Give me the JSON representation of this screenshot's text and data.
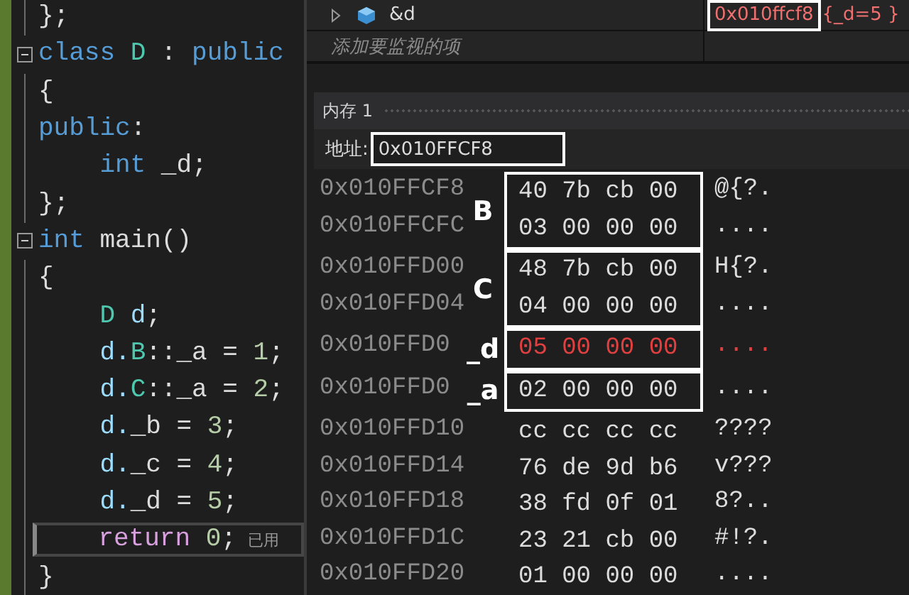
{
  "editor": {
    "lines": [
      {
        "fold": false,
        "current": false,
        "tokens": [
          {
            "kind": "text",
            "text": "};"
          }
        ]
      },
      {
        "fold": true,
        "current": false,
        "tokens": [
          {
            "kind": "kw",
            "text": "class "
          },
          {
            "kind": "type",
            "text": "D"
          },
          {
            "kind": "text",
            "text": " : "
          },
          {
            "kind": "kw",
            "text": "public"
          }
        ]
      },
      {
        "fold": false,
        "current": false,
        "tokens": [
          {
            "kind": "text",
            "text": "{"
          }
        ]
      },
      {
        "fold": false,
        "current": false,
        "tokens": [
          {
            "kind": "kw",
            "text": "public"
          },
          {
            "kind": "text",
            "text": ":"
          }
        ]
      },
      {
        "fold": false,
        "current": false,
        "tokens": [
          {
            "kind": "kw",
            "text": "    int "
          },
          {
            "kind": "text",
            "text": "_d;"
          }
        ]
      },
      {
        "fold": false,
        "current": false,
        "tokens": [
          {
            "kind": "text",
            "text": "};"
          }
        ]
      },
      {
        "fold": true,
        "current": false,
        "tokens": [
          {
            "kind": "kw",
            "text": "int "
          },
          {
            "kind": "text",
            "text": "main()"
          }
        ]
      },
      {
        "fold": false,
        "current": false,
        "tokens": [
          {
            "kind": "text",
            "text": "{"
          }
        ]
      },
      {
        "fold": false,
        "current": false,
        "tokens": [
          {
            "kind": "type",
            "text": "    D "
          },
          {
            "kind": "var",
            "text": "d"
          },
          {
            "kind": "text",
            "text": ";"
          }
        ]
      },
      {
        "fold": false,
        "current": false,
        "tokens": [
          {
            "kind": "var",
            "text": "    d."
          },
          {
            "kind": "type",
            "text": "B"
          },
          {
            "kind": "text",
            "text": "::_a = "
          },
          {
            "kind": "num",
            "text": "1"
          },
          {
            "kind": "text",
            "text": ";"
          }
        ]
      },
      {
        "fold": false,
        "current": false,
        "tokens": [
          {
            "kind": "var",
            "text": "    d."
          },
          {
            "kind": "type",
            "text": "C"
          },
          {
            "kind": "text",
            "text": "::_a = "
          },
          {
            "kind": "num",
            "text": "2"
          },
          {
            "kind": "text",
            "text": ";"
          }
        ]
      },
      {
        "fold": false,
        "current": false,
        "tokens": [
          {
            "kind": "var",
            "text": "    d."
          },
          {
            "kind": "text",
            "text": "_b = "
          },
          {
            "kind": "num",
            "text": "3"
          },
          {
            "kind": "text",
            "text": ";"
          }
        ]
      },
      {
        "fold": false,
        "current": false,
        "tokens": [
          {
            "kind": "var",
            "text": "    d."
          },
          {
            "kind": "text",
            "text": "_c = "
          },
          {
            "kind": "num",
            "text": "4"
          },
          {
            "kind": "text",
            "text": ";"
          }
        ]
      },
      {
        "fold": false,
        "current": false,
        "tokens": [
          {
            "kind": "var",
            "text": "    d."
          },
          {
            "kind": "text",
            "text": "_d = "
          },
          {
            "kind": "num",
            "text": "5"
          },
          {
            "kind": "text",
            "text": ";"
          }
        ]
      },
      {
        "fold": false,
        "current": true,
        "hint": "已用",
        "tokens": [
          {
            "kind": "ctrl",
            "text": "    return "
          },
          {
            "kind": "num",
            "text": "0"
          },
          {
            "kind": "text",
            "text": ";"
          }
        ]
      },
      {
        "fold": false,
        "current": false,
        "tokens": [
          {
            "kind": "text",
            "text": "}"
          }
        ]
      }
    ]
  },
  "watch": {
    "rows": [
      {
        "kind": "item",
        "name": "&d",
        "value": "0x010ffcf8",
        "detail": "{_d=5 }"
      },
      {
        "kind": "add",
        "name": "添加要监视的项"
      }
    ]
  },
  "memory": {
    "title": "内存 1",
    "address_label": "地址:",
    "address": "0x010FFCF8",
    "groups": [
      {
        "boxed": true,
        "label": "B",
        "rows": [
          {
            "address": "0x010FFCF8",
            "bytes": "40 7b cb 00",
            "ascii": "@{?.",
            "changed": false
          },
          {
            "address": "0x010FFCFC",
            "bytes": "03 00 00 00",
            "ascii": "....",
            "changed": false
          }
        ]
      },
      {
        "boxed": true,
        "label": "C",
        "rows": [
          {
            "address": "0x010FFD00",
            "bytes": "48 7b cb 00",
            "ascii": "H{?.",
            "changed": false
          },
          {
            "address": "0x010FFD04",
            "bytes": "04 00 00 00",
            "ascii": "....",
            "changed": false
          }
        ]
      },
      {
        "boxed": true,
        "label": "_d",
        "rows": [
          {
            "address": "0x010FFD0",
            "bytes": "05 00 00 00",
            "ascii": "....",
            "changed": true
          }
        ]
      },
      {
        "boxed": true,
        "label": "_a",
        "rows": [
          {
            "address": "0x010FFD0",
            "bytes": "02 00 00 00",
            "ascii": "....",
            "changed": false
          }
        ]
      },
      {
        "boxed": false,
        "rows": [
          {
            "address": "0x010FFD10",
            "bytes": "cc cc cc cc",
            "ascii": "????",
            "changed": false
          },
          {
            "address": "0x010FFD14",
            "bytes": "76 de 9d b6",
            "ascii": "v???",
            "changed": false
          },
          {
            "address": "0x010FFD18",
            "bytes": "38 fd 0f 01",
            "ascii": "8?..",
            "changed": false
          },
          {
            "address": "0x010FFD1C",
            "bytes": "23 21 cb 00",
            "ascii": "#!?.",
            "changed": false
          },
          {
            "address": "0x010FFD20",
            "bytes": "01 00 00 00",
            "ascii": "....",
            "changed": false
          }
        ]
      }
    ]
  }
}
